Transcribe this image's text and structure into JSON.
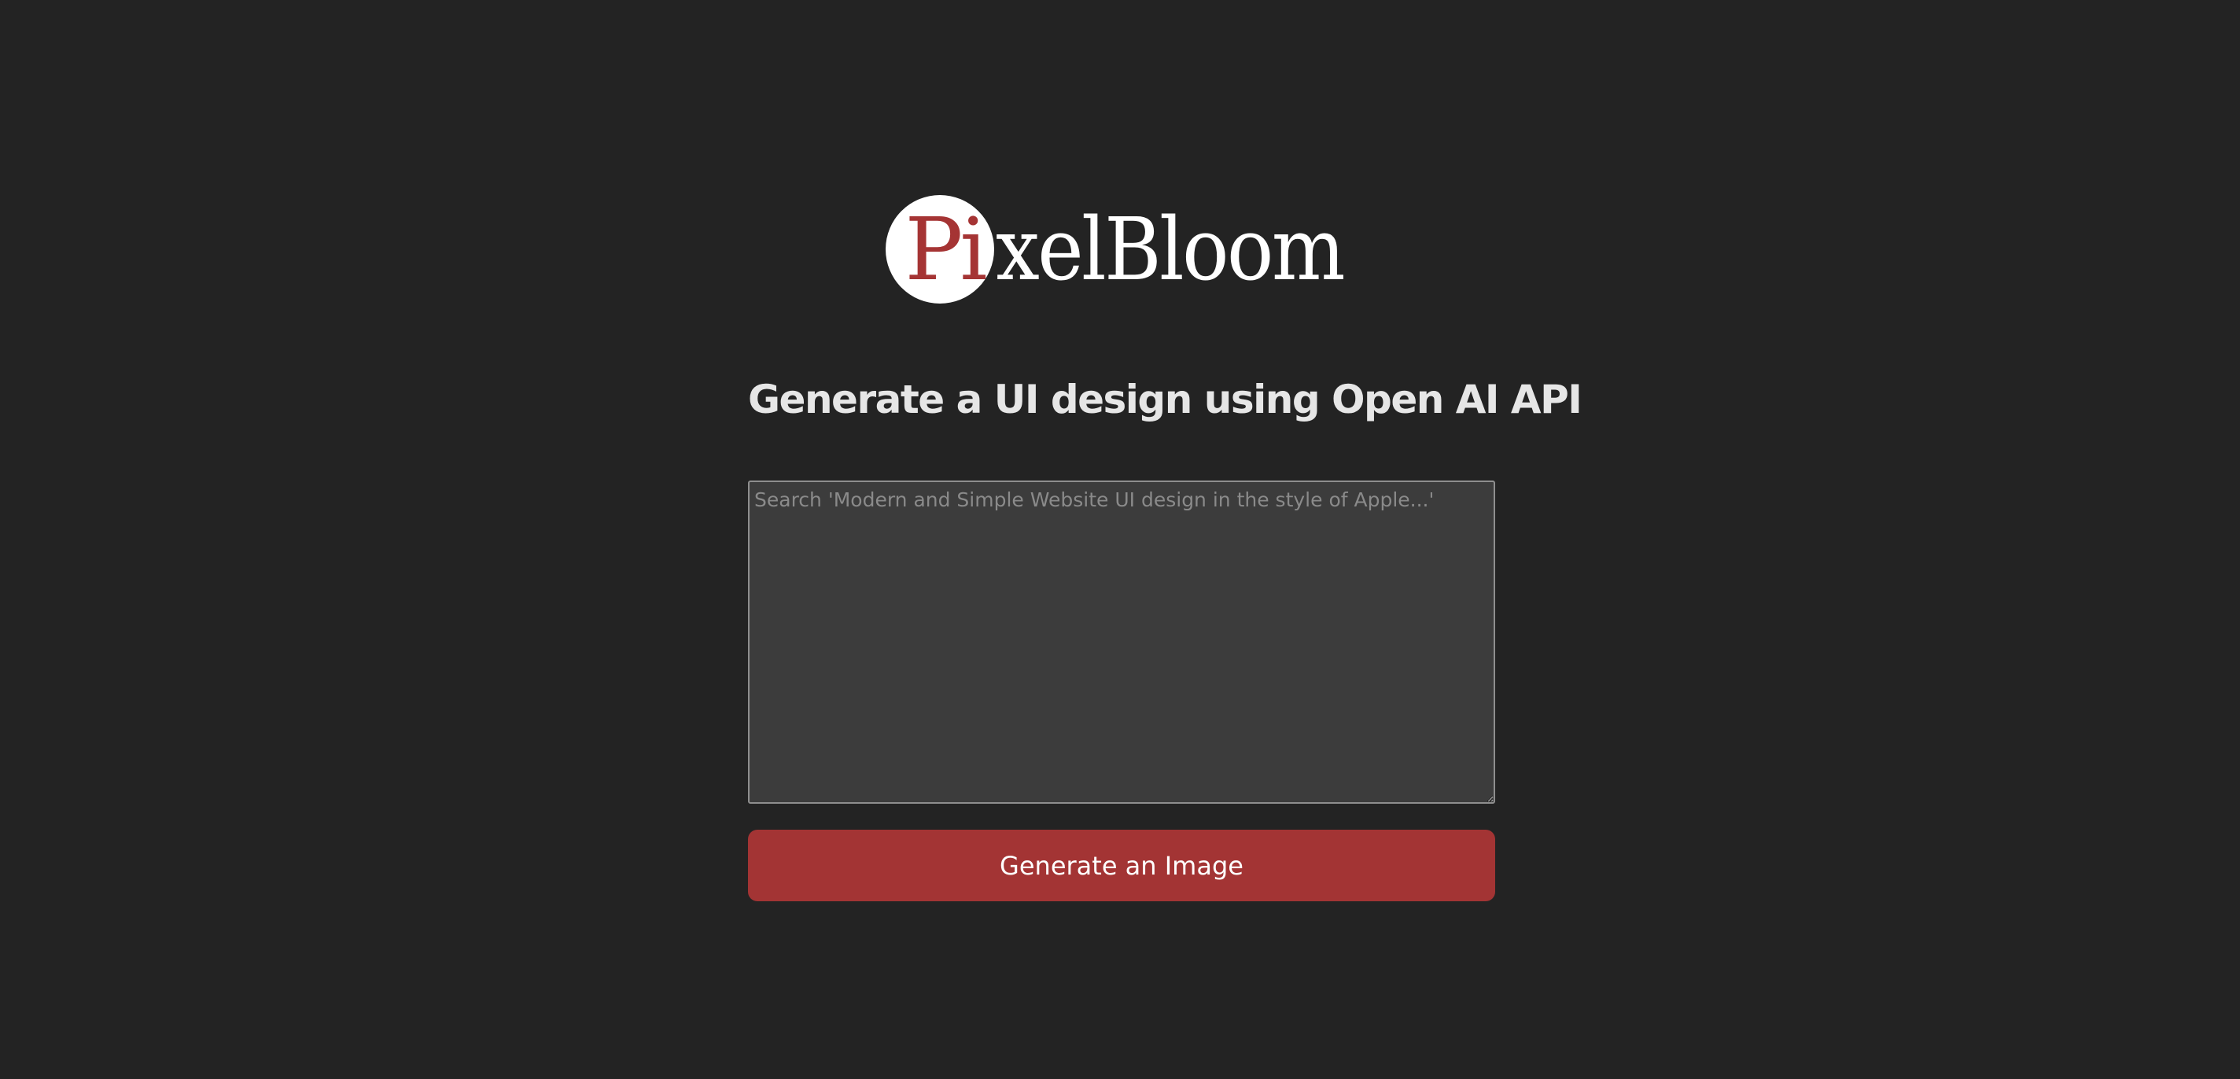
{
  "brand": {
    "name_accent": "Pi",
    "name_rest": "xelBloom",
    "accent_color": "#a53434"
  },
  "main": {
    "heading": "Generate a UI design using Open AI API",
    "prompt": {
      "placeholder": "Search 'Modern and Simple Website UI design in the style of Apple...'",
      "value": ""
    },
    "generate_button_label": "Generate an Image",
    "button_color": "#a33434"
  }
}
